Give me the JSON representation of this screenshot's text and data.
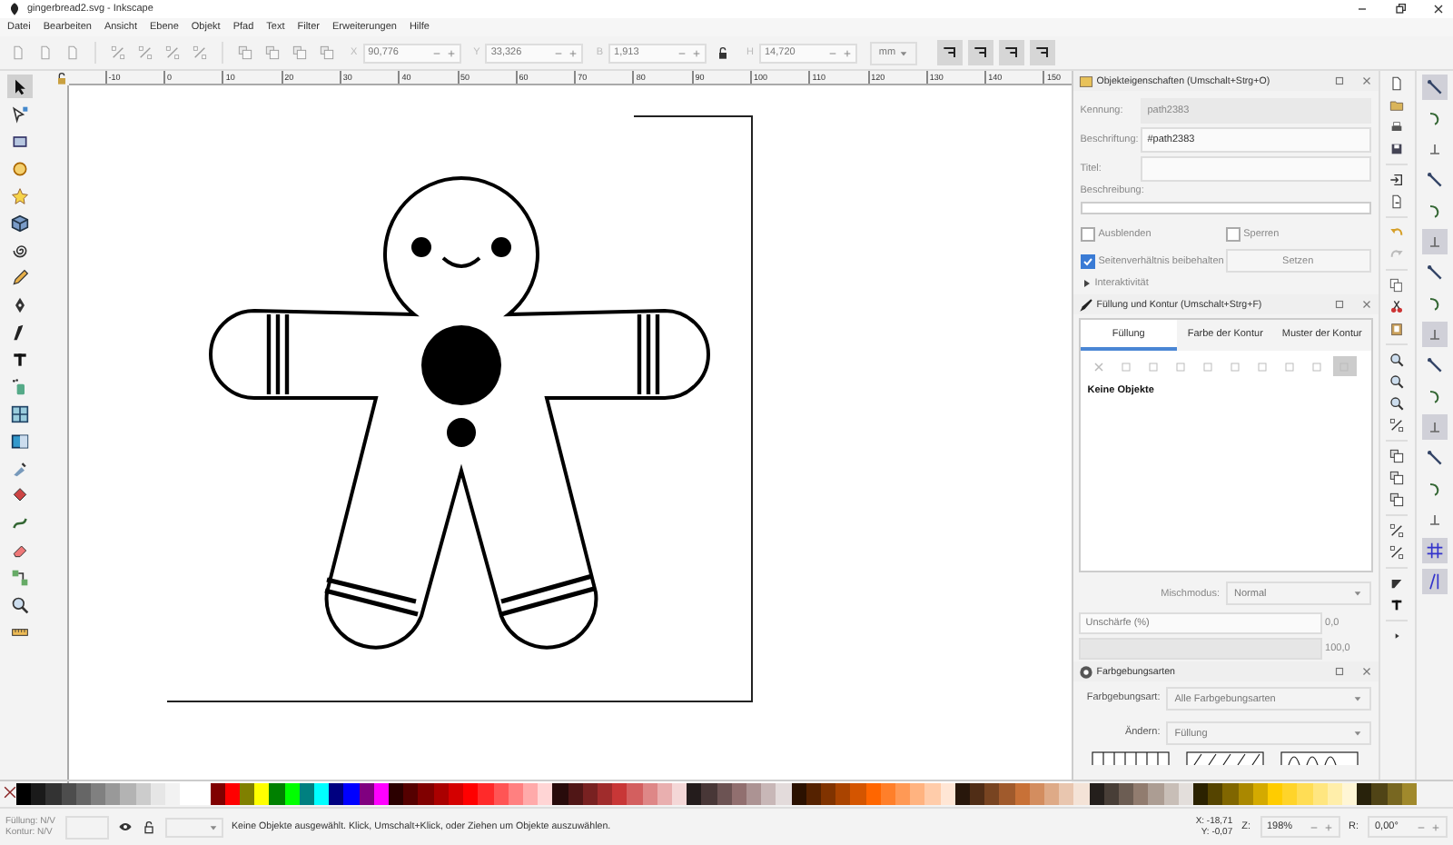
{
  "window": {
    "title": "gingerbread2.svg - Inkscape"
  },
  "menu": [
    "Datei",
    "Bearbeiten",
    "Ansicht",
    "Ebene",
    "Objekt",
    "Pfad",
    "Text",
    "Filter",
    "Erweiterungen",
    "Hilfe"
  ],
  "toolbar": {
    "fields": [
      {
        "label": "X",
        "value": "90,776"
      },
      {
        "label": "Y",
        "value": "33,326"
      },
      {
        "label": "B",
        "value": "1,913"
      },
      {
        "label": "H",
        "value": "14,720"
      }
    ],
    "unit": "mm",
    "transform_toggles": [
      {
        "selected": true
      },
      {
        "selected": true
      },
      {
        "selected": true
      },
      {
        "selected": true
      }
    ]
  },
  "ruler": {
    "labels": [
      "-10",
      "0",
      "10",
      "20",
      "30",
      "40",
      "50",
      "60",
      "70",
      "80",
      "90",
      "100",
      "110",
      "120",
      "130",
      "140",
      "150"
    ]
  },
  "tools": [
    {
      "kind": "select",
      "selected": true
    },
    {
      "kind": "node",
      "selected": false
    },
    {
      "kind": "rect",
      "selected": false
    },
    {
      "kind": "circle",
      "selected": false
    },
    {
      "kind": "star",
      "selected": false
    },
    {
      "kind": "box",
      "selected": false
    },
    {
      "kind": "spiral",
      "selected": false
    },
    {
      "kind": "pencil",
      "selected": false
    },
    {
      "kind": "pen",
      "selected": false
    },
    {
      "kind": "calligraphy",
      "selected": false
    },
    {
      "kind": "text",
      "selected": false
    },
    {
      "kind": "spray",
      "selected": false
    },
    {
      "kind": "mesh",
      "selected": false
    },
    {
      "kind": "gradient",
      "selected": false
    },
    {
      "kind": "dropper",
      "selected": false
    },
    {
      "kind": "bucket",
      "selected": false
    },
    {
      "kind": "tweak",
      "selected": false
    },
    {
      "kind": "eraser",
      "selected": false
    },
    {
      "kind": "connector",
      "selected": false
    },
    {
      "kind": "zoom",
      "selected": false
    },
    {
      "kind": "measure",
      "selected": false
    }
  ],
  "object_properties": {
    "title": "Objekteigenschaften (Umschalt+Strg+O)",
    "fields": [
      {
        "label": "Kennung:",
        "value": "path2383",
        "disabled": true
      },
      {
        "label": "Beschriftung:",
        "value": "#path2383",
        "disabled": false
      },
      {
        "label": "Titel:",
        "disabled": false
      }
    ],
    "description_label": "Beschreibung:",
    "checkboxes": [
      {
        "label": "Ausblenden",
        "checked": false
      },
      {
        "label": "Sperren",
        "checked": false
      },
      {
        "label": "Seitenverhältnis beibehalten",
        "checked": true
      }
    ],
    "set_button": "Setzen",
    "expander": {
      "label": "Interaktivität",
      "expanded": false
    }
  },
  "fill_stroke": {
    "title": "Füllung und Kontur (Umschalt+Strg+F)",
    "tabs": [
      {
        "label": "Füllung",
        "selected": true
      },
      {
        "label": "Farbe der Kontur",
        "selected": false
      },
      {
        "label": "Muster der Kontur",
        "selected": false
      }
    ],
    "paint_modes": [
      {
        "selected": false
      },
      {
        "selected": false
      },
      {
        "selected": false
      },
      {
        "selected": false
      },
      {
        "selected": false
      },
      {
        "selected": false
      },
      {
        "selected": false
      },
      {
        "selected": false
      },
      {
        "selected": false
      },
      {
        "selected": true
      }
    ],
    "message": "Keine Objekte",
    "blend_label": "Mischmodus:",
    "blend_value": "Normal",
    "blur": {
      "label": "Unschärfe (%)",
      "level": 0,
      "value": "0,0"
    },
    "opacity": {
      "level": 1,
      "value": "100,0"
    }
  },
  "swatches": {
    "title": "Farbgebungsarten",
    "rows": [
      {
        "label": "Farbgebungsart:",
        "value": "Alle Farbgebungsarten"
      },
      {
        "label": "Ändern:",
        "value": "Füllung"
      }
    ]
  },
  "snap_controls": [
    {
      "on": true
    },
    {
      "on": false
    },
    {
      "on": false
    },
    {
      "on": false
    },
    {
      "on": false
    },
    {
      "on": true
    },
    {
      "on": false
    },
    {
      "on": false
    },
    {
      "on": true
    },
    {
      "on": false
    },
    {
      "on": false
    },
    {
      "on": true
    },
    {
      "on": false
    },
    {
      "on": false
    },
    {
      "on": false
    },
    {
      "on": true
    },
    {
      "on": true
    }
  ],
  "palette": [
    {
      "color": "#000000"
    },
    {
      "color": "#1a1a1a"
    },
    {
      "color": "#333333"
    },
    {
      "color": "#4d4d4d"
    },
    {
      "color": "#666666"
    },
    {
      "color": "#808080"
    },
    {
      "color": "#999999"
    },
    {
      "color": "#b3b3b3"
    },
    {
      "color": "#cccccc"
    },
    {
      "color": "#e6e6e6"
    },
    {
      "color": "#f2f2f2"
    },
    {
      "color": "#ffffff"
    },
    {
      "color": "#ffffff"
    },
    {
      "color": "#800000"
    },
    {
      "color": "#ff0000"
    },
    {
      "color": "#808000"
    },
    {
      "color": "#ffff00"
    },
    {
      "color": "#008000"
    },
    {
      "color": "#00ff00"
    },
    {
      "color": "#008080"
    },
    {
      "color": "#00ffff"
    },
    {
      "color": "#000080"
    },
    {
      "color": "#0000ff"
    },
    {
      "color": "#800080"
    },
    {
      "color": "#ff00ff"
    },
    {
      "color": "#2b0000"
    },
    {
      "color": "#550000"
    },
    {
      "color": "#800000"
    },
    {
      "color": "#aa0000"
    },
    {
      "color": "#d40000"
    },
    {
      "color": "#ff0000"
    },
    {
      "color": "#ff2a2a"
    },
    {
      "color": "#ff5555"
    },
    {
      "color": "#ff8080"
    },
    {
      "color": "#ffaaaa"
    },
    {
      "color": "#ffd5d5"
    },
    {
      "color": "#280b0b"
    },
    {
      "color": "#501616"
    },
    {
      "color": "#782121"
    },
    {
      "color": "#a02c2c"
    },
    {
      "color": "#c83737"
    },
    {
      "color": "#d35f5f"
    },
    {
      "color": "#de8787"
    },
    {
      "color": "#e9afaf"
    },
    {
      "color": "#f4d7d7"
    },
    {
      "color": "#241c1c"
    },
    {
      "color": "#483737"
    },
    {
      "color": "#6c5353"
    },
    {
      "color": "#916f6f"
    },
    {
      "color": "#ac9393"
    },
    {
      "color": "#c8b7b7"
    },
    {
      "color": "#e3dbdb"
    },
    {
      "color": "#2b1100"
    },
    {
      "color": "#552200"
    },
    {
      "color": "#803300"
    },
    {
      "color": "#aa4400"
    },
    {
      "color": "#d45500"
    },
    {
      "color": "#ff6600"
    },
    {
      "color": "#ff7f2a"
    },
    {
      "color": "#ff9955"
    },
    {
      "color": "#ffb380"
    },
    {
      "color": "#ffccaa"
    },
    {
      "color": "#ffe6d5"
    },
    {
      "color": "#28170b"
    },
    {
      "color": "#502d16"
    },
    {
      "color": "#784421"
    },
    {
      "color": "#a05a2c"
    },
    {
      "color": "#c87137"
    },
    {
      "color": "#d38d5f"
    },
    {
      "color": "#deaa87"
    },
    {
      "color": "#e9c6af"
    },
    {
      "color": "#f4e3d7"
    },
    {
      "color": "#241f1c"
    },
    {
      "color": "#483e37"
    },
    {
      "color": "#6c5d53"
    },
    {
      "color": "#917c6f"
    },
    {
      "color": "#ac9d93"
    },
    {
      "color": "#c8beb7"
    },
    {
      "color": "#e3dedb"
    },
    {
      "color": "#2b2200"
    },
    {
      "color": "#554400"
    },
    {
      "color": "#806600"
    },
    {
      "color": "#aa8800"
    },
    {
      "color": "#d4aa00"
    },
    {
      "color": "#ffcc00"
    },
    {
      "color": "#ffd42a"
    },
    {
      "color": "#ffdd55"
    },
    {
      "color": "#ffe680"
    },
    {
      "color": "#ffeeaa"
    },
    {
      "color": "#fff6d5"
    },
    {
      "color": "#28220b"
    },
    {
      "color": "#504416"
    },
    {
      "color": "#786721"
    },
    {
      "color": "#a0892c"
    }
  ],
  "status": {
    "fill_label": "Füllung:",
    "fill_value": "N/V",
    "stroke_label": "Kontur:",
    "stroke_value": "N/V",
    "message": "Keine Objekte ausgewählt. Klick, Umschalt+Klick, oder Ziehen um Objekte auszuwählen.",
    "x_label": "X:",
    "x_value": "-18,71",
    "y_label": "Y:",
    "y_value": "-0,07",
    "zoom_label": "Z:",
    "zoom_value": "198%",
    "rotate_label": "R:",
    "rotate_value": "0,00°"
  }
}
